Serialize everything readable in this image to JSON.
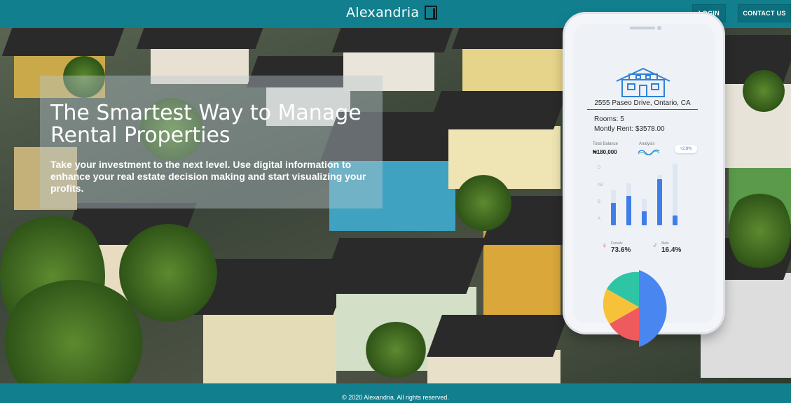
{
  "header": {
    "brand": "Alexandria",
    "login_label": "LOGIN",
    "contact_label": "CONTACT US"
  },
  "hero": {
    "title": "The Smartest Way to Manage Rental Properties",
    "subtitle": "Take your investment to the next level. Use digital information to enhance your real estate decision making and start visualizing your profits."
  },
  "phone_card": {
    "address": "2555 Paseo Drive, Ontario, CA",
    "rooms": "Rooms: 5",
    "rent": "Montly Rent: $3578.00",
    "total_balance_label": "Total Balance",
    "total_balance_value": "₦180,000",
    "analysis_label": "Analysis",
    "change_badge": "+2.8%",
    "y_labels": [
      "D",
      "AB",
      "B",
      "A"
    ],
    "female_label": "Female",
    "female_value": "73.6%",
    "male_label": "Male",
    "male_value": "16.4%"
  },
  "footer": {
    "copyright": "© 2020 Alexandria. All rights reserved."
  },
  "colors": {
    "brand": "#117f8e",
    "accent_blue": "#3f7ee8",
    "pie_teal": "#2ec4a6",
    "pie_yellow": "#f7c23a",
    "pie_red": "#ef5a5f",
    "pie_blue": "#4a86f0"
  }
}
